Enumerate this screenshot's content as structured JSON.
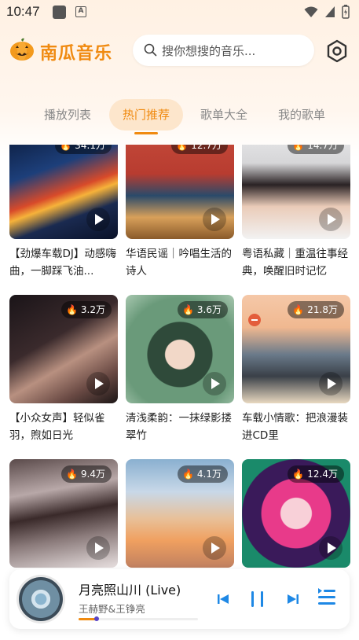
{
  "status_bar": {
    "time": "10:47",
    "notification_letter": "A"
  },
  "app": {
    "title": "南瓜音乐",
    "accent": "#f08a10"
  },
  "search": {
    "placeholder": "搜你想搜的音乐..."
  },
  "tabs": [
    {
      "label": "播放列表",
      "active": false
    },
    {
      "label": "热门推荐",
      "active": true
    },
    {
      "label": "歌单大全",
      "active": false
    },
    {
      "label": "我的歌单",
      "active": false
    }
  ],
  "cards": [
    {
      "count": "34.1万",
      "title": "【劲爆车载DJ】动感嗨曲，一脚踩飞油..."
    },
    {
      "count": "12.7万",
      "title": "华语民谣｜吟唱生活的诗人"
    },
    {
      "count": "14.7万",
      "title": "粤语私藏｜重温往事经典，唤醒旧时记忆"
    },
    {
      "count": "3.2万",
      "title": "【小众女声】轻似雀羽，煦如日光"
    },
    {
      "count": "3.6万",
      "title": "清浅柔韵：一抹绿影搂翠竹"
    },
    {
      "count": "21.8万",
      "title": "车载小情歌：把浪漫装进CD里"
    },
    {
      "count": "9.4万",
      "title": ""
    },
    {
      "count": "4.1万",
      "title": ""
    },
    {
      "count": "12.4万",
      "title": ""
    }
  ],
  "player": {
    "title": "月亮照山川 (Live)",
    "artist": "王赫野&王铮亮",
    "progress": 0.15
  }
}
